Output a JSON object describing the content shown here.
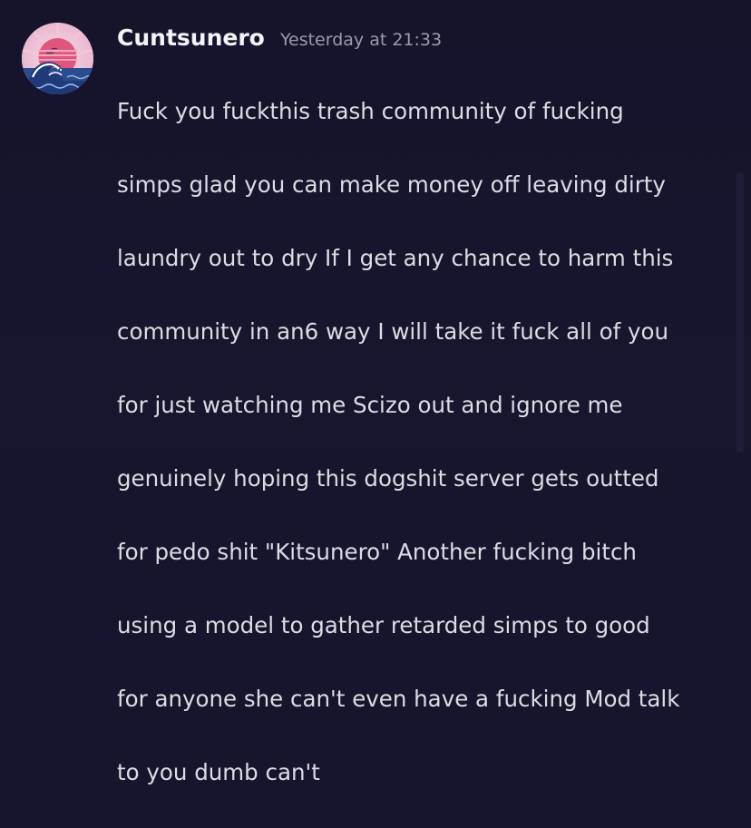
{
  "message": {
    "author": "Cuntsunero",
    "timestamp": "Yesterday at 21:33",
    "lines": [
      "Fuck you fuckthis trash community of fucking",
      "simps glad you can make money off leaving dirty",
      "laundry out to dry If I get any chance to harm this",
      "community in an6 way I will take it fuck all of you",
      "for just watching me Scizo out and ignore me",
      "genuinely hoping this dogshit server gets outted",
      "for pedo shit \"Kitsunero\" Another fucking bitch",
      "using a model to gather retarded simps to good",
      "for anyone she can't even have a fucking Mod talk",
      "to you dumb can't"
    ],
    "avatar_icon": "wave-sunset-icon"
  },
  "colors": {
    "background": "#16152e",
    "username": "#f2f3f5",
    "timestamp": "#9b9ca8",
    "text": "#dcdde3"
  }
}
